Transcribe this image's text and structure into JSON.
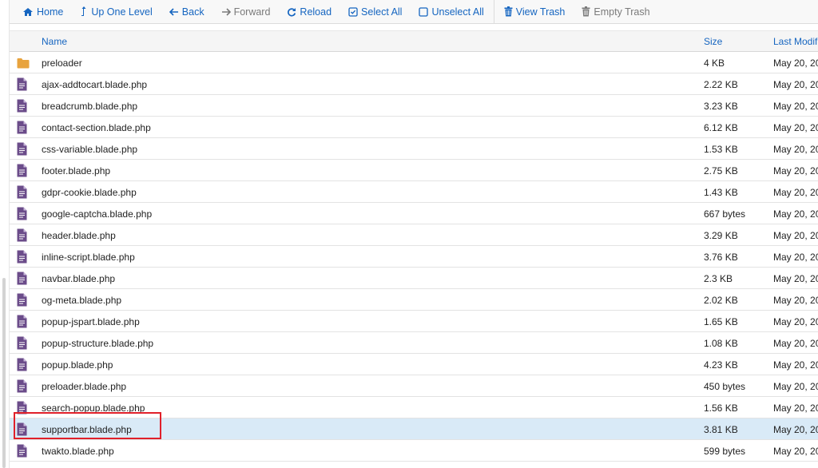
{
  "toolbar": {
    "home": "Home",
    "up_one_level": "Up One Level",
    "back": "Back",
    "forward": "Forward",
    "reload": "Reload",
    "select_all": "Select All",
    "unselect_all": "Unselect All",
    "view_trash": "View Trash",
    "empty_trash": "Empty Trash"
  },
  "table": {
    "columns": {
      "name": "Name",
      "size": "Size",
      "last_modified": "Last Modifi"
    },
    "rows": [
      {
        "name": "preloader",
        "size": "4 KB",
        "date": "May 20, 20",
        "type": "folder",
        "selected": false
      },
      {
        "name": "ajax-addtocart.blade.php",
        "size": "2.22 KB",
        "date": "May 20, 20",
        "type": "file",
        "selected": false
      },
      {
        "name": "breadcrumb.blade.php",
        "size": "3.23 KB",
        "date": "May 20, 20",
        "type": "file",
        "selected": false
      },
      {
        "name": "contact-section.blade.php",
        "size": "6.12 KB",
        "date": "May 20, 20",
        "type": "file",
        "selected": false
      },
      {
        "name": "css-variable.blade.php",
        "size": "1.53 KB",
        "date": "May 20, 20",
        "type": "file",
        "selected": false
      },
      {
        "name": "footer.blade.php",
        "size": "2.75 KB",
        "date": "May 20, 20",
        "type": "file",
        "selected": false
      },
      {
        "name": "gdpr-cookie.blade.php",
        "size": "1.43 KB",
        "date": "May 20, 20",
        "type": "file",
        "selected": false
      },
      {
        "name": "google-captcha.blade.php",
        "size": "667 bytes",
        "date": "May 20, 20",
        "type": "file",
        "selected": false
      },
      {
        "name": "header.blade.php",
        "size": "3.29 KB",
        "date": "May 20, 20",
        "type": "file",
        "selected": false
      },
      {
        "name": "inline-script.blade.php",
        "size": "3.76 KB",
        "date": "May 20, 20",
        "type": "file",
        "selected": false
      },
      {
        "name": "navbar.blade.php",
        "size": "2.3 KB",
        "date": "May 20, 20",
        "type": "file",
        "selected": false
      },
      {
        "name": "og-meta.blade.php",
        "size": "2.02 KB",
        "date": "May 20, 20",
        "type": "file",
        "selected": false
      },
      {
        "name": "popup-jspart.blade.php",
        "size": "1.65 KB",
        "date": "May 20, 20",
        "type": "file",
        "selected": false
      },
      {
        "name": "popup-structure.blade.php",
        "size": "1.08 KB",
        "date": "May 20, 20",
        "type": "file",
        "selected": false
      },
      {
        "name": "popup.blade.php",
        "size": "4.23 KB",
        "date": "May 20, 20",
        "type": "file",
        "selected": false
      },
      {
        "name": "preloader.blade.php",
        "size": "450 bytes",
        "date": "May 20, 20",
        "type": "file",
        "selected": false
      },
      {
        "name": "search-popup.blade.php",
        "size": "1.56 KB",
        "date": "May 20, 20",
        "type": "file",
        "selected": false
      },
      {
        "name": "supportbar.blade.php",
        "size": "3.81 KB",
        "date": "May 20, 20",
        "type": "file",
        "selected": true
      },
      {
        "name": "twakto.blade.php",
        "size": "599 bytes",
        "date": "May 20, 20",
        "type": "file",
        "selected": false
      }
    ]
  },
  "colors": {
    "link": "#1565c0",
    "folder_icon": "#e8a33d",
    "file_icon": "#6b4c8a",
    "selected_row": "#d9eaf7",
    "highlight": "#e0202a"
  }
}
